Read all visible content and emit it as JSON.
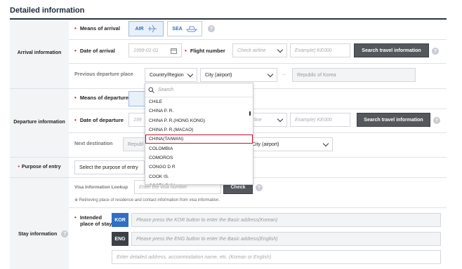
{
  "page": {
    "title": "Detailed information"
  },
  "sections": {
    "arrival": "Arrival information",
    "departure": "Departure information",
    "purpose": "Purpose of entry",
    "stay": "Stay information"
  },
  "arrival": {
    "means_label": "Means of arrival",
    "air_label": "AIR",
    "sea_label": "SEA",
    "date_label": "Date of arrival",
    "date_placeholder": "1999-01-01",
    "flight_label": "Flight number",
    "airline_placeholder": "Check airline",
    "flight_placeholder": "Example) KE000",
    "search_btn": "Search travel information",
    "prev_label": "Previous departure place",
    "country_select": "Country/Region",
    "city_select": "City (airport)",
    "destination_value": "Republic of Korea"
  },
  "departure": {
    "means_label": "Means of departure",
    "date_label": "Date of departure",
    "date_placeholder": "199",
    "airline_placeholder": "irline",
    "flight_placeholder": "Example) KE000",
    "search_btn": "Search travel information",
    "next_label": "Next destination",
    "next_country_partial": "Republ",
    "city_select": "City (airport)"
  },
  "purpose": {
    "select": "Select the purpose of entry"
  },
  "visa": {
    "label": "Visa Information Lookup",
    "placeholder": "Enter the visa number",
    "check_btn": "Check",
    "note": "※ Retrieving place of residence and contact information from visa information."
  },
  "stay": {
    "place_label_1": "Intended",
    "place_label_2": "place of stay",
    "kor_btn": "KOR",
    "kor_placeholder": "Please press the KOR button to enter the Basic address(Korean)",
    "eng_btn": "ENG",
    "eng_placeholder": "Please press the ENG button to enter the Basic address(English)",
    "detail_placeholder": "Enter detailed address, accommodation name, etc. (Korean or English)"
  },
  "dropdown": {
    "search_placeholder": "Search",
    "items": [
      "CHILE",
      "CHINA P. R.",
      "CHINA P. R.(HONG KONG)",
      "CHINA P. R.(MACAO)",
      "CHINA(TAIWAN)",
      "COLOMBIA",
      "COMOROS",
      "CONGO D R",
      "COOK IS.",
      "COSTA RICA"
    ],
    "highlighted": "CHINA(TAIWAN)"
  },
  "help_glyph": "?",
  "colors": {
    "required": "#d31f2a",
    "kor": "#2f6fc4",
    "eng": "#3d4147",
    "highlight": "#c8102e"
  }
}
